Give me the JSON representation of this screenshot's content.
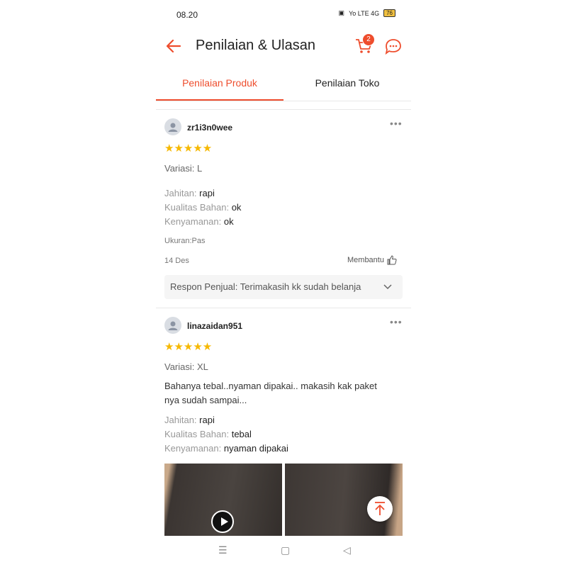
{
  "status": {
    "time": "08.20",
    "battery": "76",
    "signal_text": "Yo LTE 4G"
  },
  "header": {
    "title": "Penilaian & Ulasan",
    "cart_count": "2"
  },
  "tabs": [
    {
      "label": "Penilaian Produk",
      "active": true
    },
    {
      "label": "Penilaian Toko",
      "active": false
    }
  ],
  "reviews": [
    {
      "username": "zr1i3n0wee",
      "stars": "★★★★★",
      "variation": "Variasi: L",
      "attributes": [
        {
          "label": "Jahitan:",
          "value": "rapi"
        },
        {
          "label": "Kualitas Bahan:",
          "value": "ok"
        },
        {
          "label": "Kenyamanan:",
          "value": "ok"
        }
      ],
      "size_note": "Ukuran:Pas",
      "date": "14 Des",
      "helpful_label": "Membantu",
      "seller_response": "Respon Penjual: Terimakasih kk sudah belanja"
    },
    {
      "username": "linazaidan951",
      "stars": "★★★★★",
      "variation": "Variasi: XL",
      "comment_line1": "Bahanya tebal..nyaman dipakai.. makasih kak paket",
      "comment_line2": "nya sudah sampai...",
      "attributes": [
        {
          "label": "Jahitan:",
          "value": "rapi"
        },
        {
          "label": "Kualitas Bahan:",
          "value": "tebal"
        },
        {
          "label": "Kenyamanan:",
          "value": "nyaman dipakai"
        }
      ]
    }
  ],
  "navbar": {
    "menu": "☰",
    "home": "▢",
    "back": "◁"
  },
  "colors": {
    "accent": "#ee4d2d",
    "star": "#f6b800"
  }
}
